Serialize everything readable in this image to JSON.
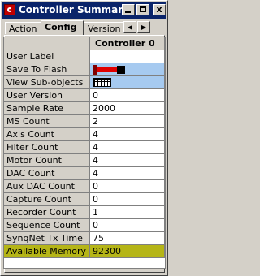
{
  "window": {
    "title": "Controller Summary",
    "buttons": {
      "min": "_",
      "max": "□",
      "close": "x"
    }
  },
  "tabs": [
    {
      "label": "Action",
      "active": false
    },
    {
      "label": "Config",
      "active": true
    },
    {
      "label": "Version",
      "active": false
    }
  ],
  "table": {
    "column_header": "Controller 0",
    "rows": [
      {
        "label": "User Label",
        "value": ""
      },
      {
        "label": "Save To Flash",
        "value": "",
        "icon": "save-flash-icon"
      },
      {
        "label": "View Sub-objects",
        "value": "",
        "icon": "sub-objects-grid-icon"
      },
      {
        "label": "User Version",
        "value": "0"
      },
      {
        "label": "Sample Rate",
        "value": "2000"
      },
      {
        "label": "MS Count",
        "value": "2"
      },
      {
        "label": "Axis Count",
        "value": "4"
      },
      {
        "label": "Filter Count",
        "value": "4"
      },
      {
        "label": "Motor Count",
        "value": "4"
      },
      {
        "label": "DAC Count",
        "value": "4"
      },
      {
        "label": "Aux DAC Count",
        "value": "0"
      },
      {
        "label": "Capture Count",
        "value": "0"
      },
      {
        "label": "Recorder Count",
        "value": "1"
      },
      {
        "label": "Sequence Count",
        "value": "0"
      },
      {
        "label": "SynqNet Tx Time",
        "value": "75"
      },
      {
        "label": "Available Memory",
        "value": "92300",
        "highlight": true
      }
    ]
  },
  "colors": {
    "titlebar": "#0a246a",
    "highlight": "#b5b517",
    "button_cell": "#a6caf0"
  }
}
